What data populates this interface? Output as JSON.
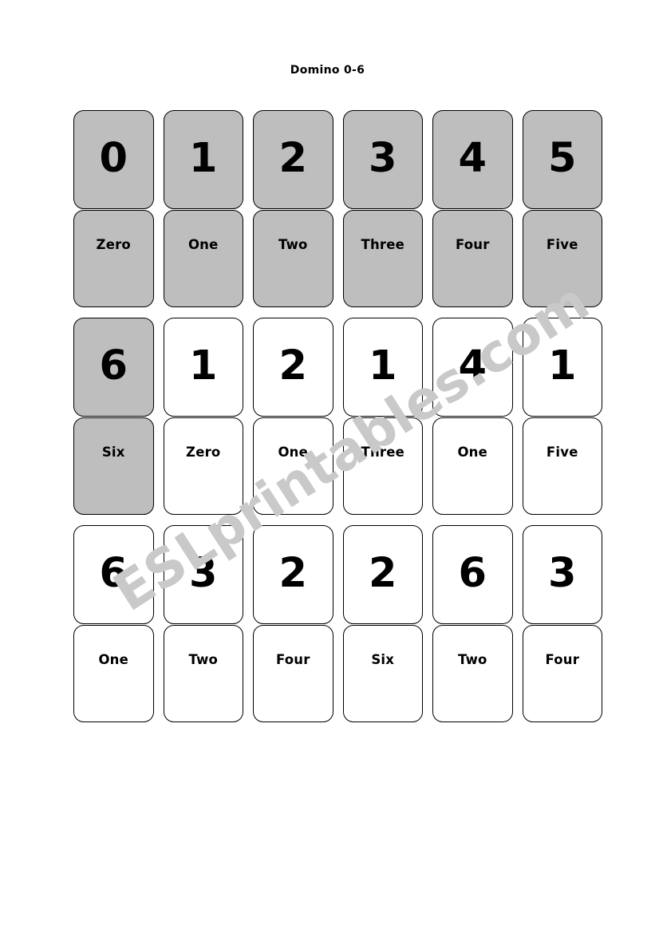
{
  "page": {
    "title": "Domino 0-6",
    "watermark": "ESLprintables.com",
    "colors": {
      "shaded_card_fill": "#bebebe",
      "card_fill": "#ffffff",
      "card_border": "#000000",
      "text": "#000000",
      "watermark": "#c9c9c9"
    }
  },
  "grid": {
    "rows": [
      {
        "cards": [
          {
            "number": "0",
            "word": "Zero",
            "shaded": true
          },
          {
            "number": "1",
            "word": "One",
            "shaded": true
          },
          {
            "number": "2",
            "word": "Two",
            "shaded": true
          },
          {
            "number": "3",
            "word": "Three",
            "shaded": true
          },
          {
            "number": "4",
            "word": "Four",
            "shaded": true
          },
          {
            "number": "5",
            "word": "Five",
            "shaded": true
          }
        ]
      },
      {
        "cards": [
          {
            "number": "6",
            "word": "Six",
            "shaded": true
          },
          {
            "number": "1",
            "word": "Zero",
            "shaded": false
          },
          {
            "number": "2",
            "word": "One",
            "shaded": false
          },
          {
            "number": "1",
            "word": "Three",
            "shaded": false
          },
          {
            "number": "4",
            "word": "One",
            "shaded": false
          },
          {
            "number": "1",
            "word": "Five",
            "shaded": false
          }
        ]
      },
      {
        "cards": [
          {
            "number": "6",
            "word": "One",
            "shaded": false
          },
          {
            "number": "3",
            "word": "Two",
            "shaded": false
          },
          {
            "number": "2",
            "word": "Four",
            "shaded": false
          },
          {
            "number": "2",
            "word": "Six",
            "shaded": false
          },
          {
            "number": "6",
            "word": "Two",
            "shaded": false
          },
          {
            "number": "3",
            "word": "Four",
            "shaded": false
          }
        ]
      }
    ]
  }
}
